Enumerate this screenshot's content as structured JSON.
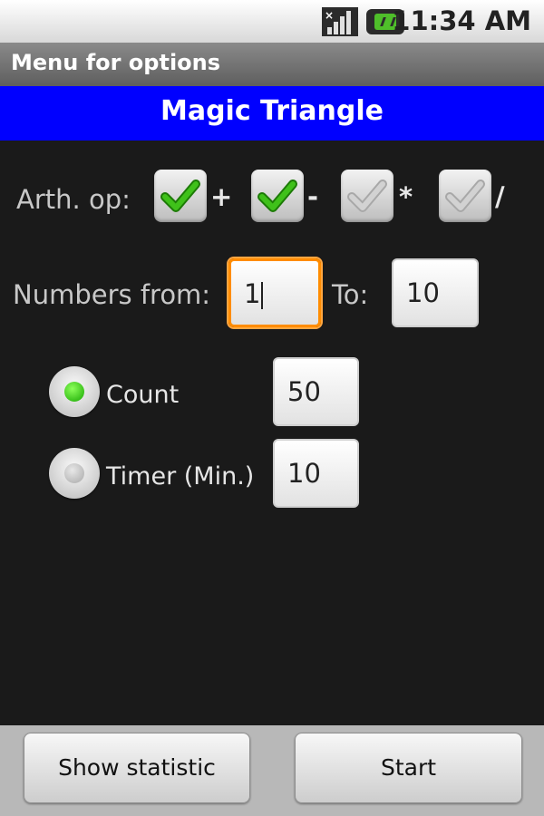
{
  "status_bar": {
    "time": "11:34 AM",
    "signal_icon": "signal-icon",
    "battery_icon": "battery-charging-icon"
  },
  "title_bar": {
    "title": "Menu for options"
  },
  "header": {
    "title": "Magic Triangle"
  },
  "arith_ops": {
    "label": "Arth. op:",
    "ops": [
      {
        "symbol": "+",
        "checked": true
      },
      {
        "symbol": "-",
        "checked": true
      },
      {
        "symbol": "*",
        "checked": false
      },
      {
        "symbol": "/",
        "checked": false
      }
    ]
  },
  "numbers": {
    "from_label": "Numbers from:",
    "from_value": "1",
    "to_label": "To:",
    "to_value": "10"
  },
  "mode": {
    "count_label": "Count",
    "count_value": "50",
    "count_selected": true,
    "timer_label": "Timer (Min.)",
    "timer_value": "10",
    "timer_selected": false
  },
  "buttons": {
    "show_statistic": "Show statistic",
    "start": "Start"
  },
  "colors": {
    "header_blue": "#0000ff",
    "check_green": "#3fc11a",
    "focus_orange": "#ff8c00",
    "radio_green": "#16a600"
  }
}
